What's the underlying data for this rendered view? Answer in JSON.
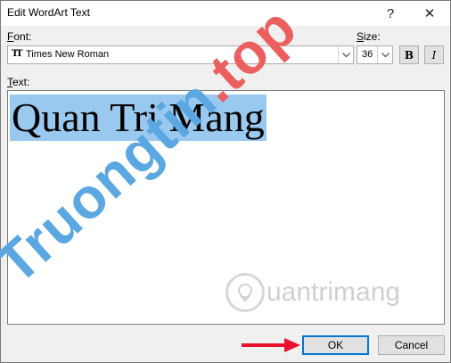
{
  "dialog": {
    "title": "Edit WordArt Text",
    "help_glyph": "?",
    "close_glyph": "✕"
  },
  "font": {
    "label_key": "F",
    "label_rest": "ont:",
    "value": "Times New Roman",
    "glyph": "TT"
  },
  "size": {
    "label_key": "S",
    "label_rest": "ize:",
    "value": "36"
  },
  "format": {
    "bold_label": "B",
    "italic_label": "I"
  },
  "text": {
    "label_key": "T",
    "label_rest": "ext:",
    "content": "Quan Tri Mang"
  },
  "watermarks": {
    "site1_part1": "Truongtin",
    "site1_part2": ".top",
    "site2": "uantrimang"
  },
  "buttons": {
    "ok": "OK",
    "cancel": "Cancel"
  },
  "colors": {
    "selection": "#99c9ef",
    "annotation_arrow": "#e8112d"
  }
}
